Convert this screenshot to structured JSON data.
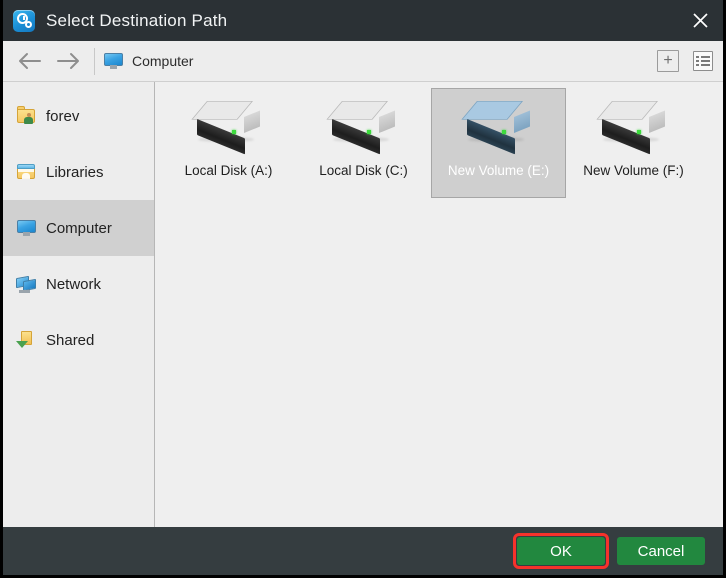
{
  "window": {
    "title": "Select Destination Path",
    "app_icon": "clock-gear-icon",
    "close_label": "close-icon"
  },
  "toolbar": {
    "back_icon": "arrow-left-icon",
    "forward_icon": "arrow-right-icon",
    "breadcrumb": {
      "icon": "computer-monitor-icon",
      "label": "Computer"
    },
    "add_button": "+",
    "add_icon": "plus-icon",
    "view_icon": "list-view-icon"
  },
  "sidebar": {
    "items": [
      {
        "label": "forev",
        "icon": "user-folder-icon",
        "selected": false
      },
      {
        "label": "Libraries",
        "icon": "libraries-icon",
        "selected": false
      },
      {
        "label": "Computer",
        "icon": "computer-monitor-icon",
        "selected": true
      },
      {
        "label": "Network",
        "icon": "network-icon",
        "selected": false
      },
      {
        "label": "Shared",
        "icon": "shared-folder-icon",
        "selected": false
      }
    ]
  },
  "content": {
    "drives": [
      {
        "label": "Local Disk (A:)",
        "icon": "hard-drive-icon",
        "selected": false
      },
      {
        "label": "Local Disk (C:)",
        "icon": "hard-drive-icon",
        "selected": false
      },
      {
        "label": "New Volume (E:)",
        "icon": "hard-drive-icon",
        "selected": true
      },
      {
        "label": "New Volume (F:)",
        "icon": "hard-drive-icon",
        "selected": false
      }
    ]
  },
  "footer": {
    "ok_label": "OK",
    "cancel_label": "Cancel",
    "ok_highlighted": true
  },
  "colors": {
    "titlebar": "#2b3135",
    "footer": "#353d40",
    "button_green": "#22883f",
    "highlight_red": "#f6322b",
    "selection_gray": "#cfcfcf",
    "sidebar_bg": "#ededed",
    "content_bg": "#efefef"
  }
}
